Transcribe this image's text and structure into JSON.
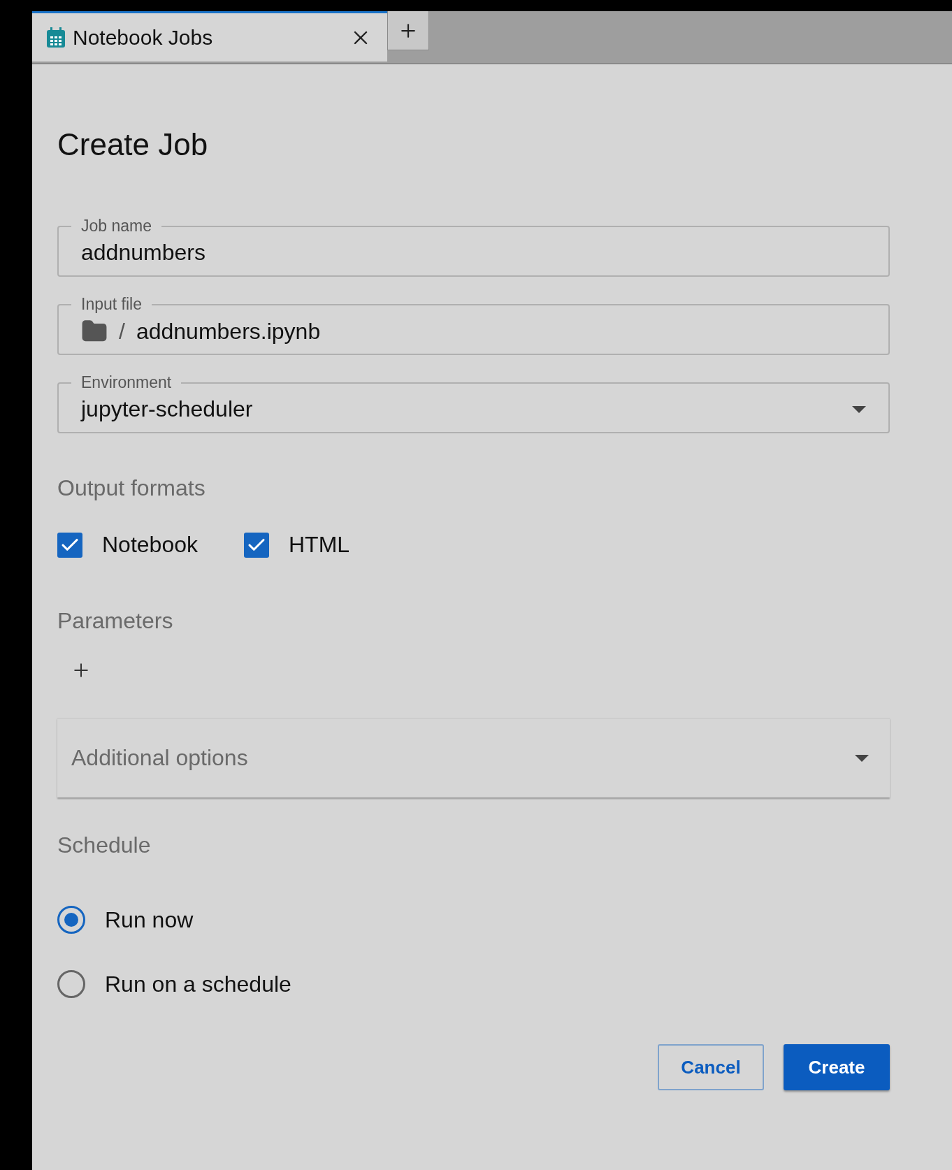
{
  "tab": {
    "title": "Notebook Jobs",
    "selected": true
  },
  "title": "Create Job",
  "fields": [
    {
      "kind": "text",
      "label": "Job name",
      "value": "addnumbers"
    },
    {
      "kind": "file",
      "label": "Input file",
      "separator": "/",
      "value": "addnumbers.ipynb"
    },
    {
      "kind": "select",
      "label": "Environment",
      "value": "jupyter-scheduler"
    }
  ],
  "output_formats": {
    "heading": "Output formats",
    "options": [
      {
        "label": "Notebook",
        "checked": true
      },
      {
        "label": "HTML",
        "checked": true
      }
    ]
  },
  "parameters": {
    "heading": "Parameters"
  },
  "additional_options": {
    "label": "Additional options",
    "expanded": false
  },
  "schedule": {
    "heading": "Schedule",
    "options": [
      {
        "label": "Run now",
        "selected": true
      },
      {
        "label": "Run on a schedule",
        "selected": false
      }
    ]
  },
  "buttons": [
    {
      "kind": "secondary",
      "label": "Cancel"
    },
    {
      "kind": "primary",
      "label": "Create"
    }
  ]
}
